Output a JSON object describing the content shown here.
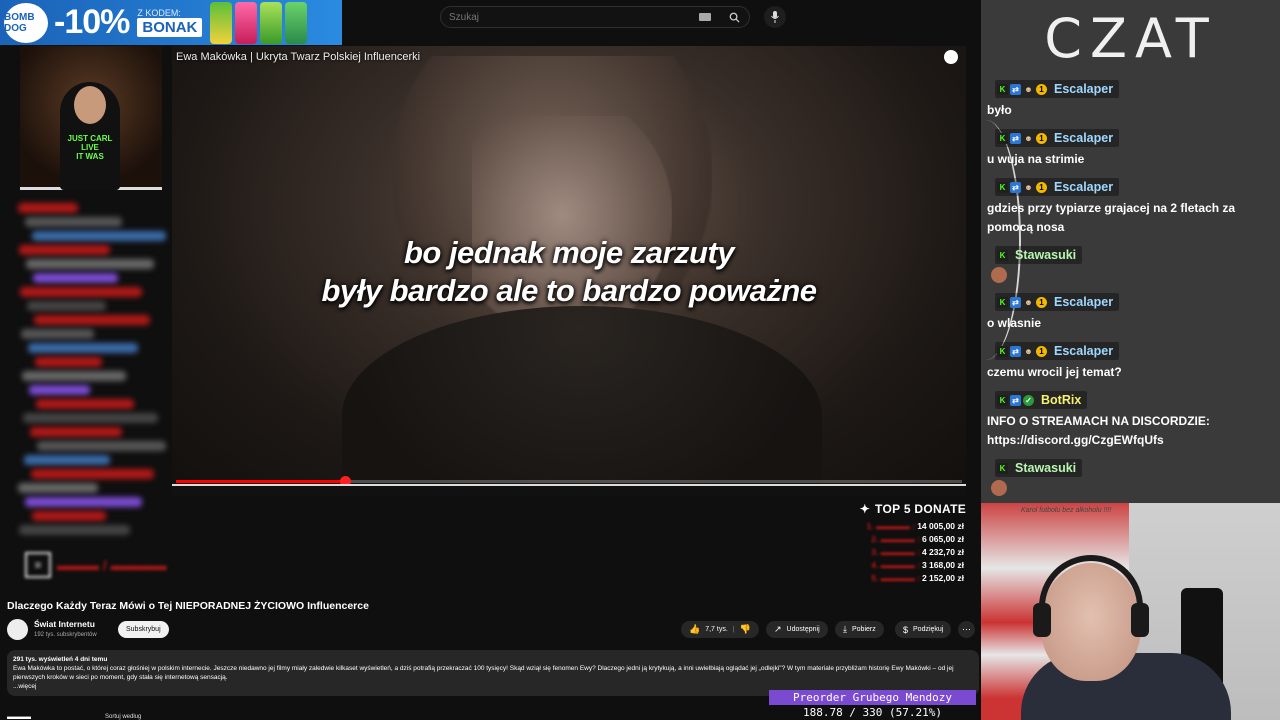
{
  "promo": {
    "discount": "-10%",
    "code_label": "Z KODEM:",
    "code": "BONAK",
    "logo": "BOMB DOG"
  },
  "search": {
    "placeholder": "Szukaj"
  },
  "video": {
    "title": "Ewa Makówka | Ukryta Twarz Polskiej Influencerki",
    "subtitle_line1": "bo jednak moje zarzuty",
    "subtitle_line2": "były bardzo ale to bardzo poważne",
    "progress": 0.215
  },
  "donates": {
    "header": "TOP 5 DONATE",
    "rows": [
      {
        "rank": "1.",
        "amount": "14 005,00 zł"
      },
      {
        "rank": "2.",
        "amount": "6 065,00 zł"
      },
      {
        "rank": "3.",
        "amount": "4 232,70 zł"
      },
      {
        "rank": "4.",
        "amount": "3 168,00 zł"
      },
      {
        "rank": "5.",
        "amount": "2 152,00 zł"
      }
    ]
  },
  "page": {
    "title": "Dlaczego Każdy Teraz Mówi o Tej NIEPORADNEJ ŻYCIOWO Influencerce",
    "channel_name": "Świat Internetu",
    "channel_subs": "192 tys. subskrybentów",
    "subscribe": "Subskrybuj",
    "likes": "7,7 tys.",
    "share": "Udostępnij",
    "download": "Pobierz",
    "thanks": "Podziękuj",
    "desc_meta": "291 tys. wyświetleń  4 dni temu",
    "desc_text": "Ewa Makówka to postać, o której coraz głośniej w polskim internecie. Jeszcze niedawno jej filmy miały zaledwie kilkaset wyświetleń, a dziś potrafią przekraczać 100 tysięcy! Skąd wziął się fenomen Ewy? Dlaczego jedni ją krytykują, a inni uwielbiają oglądać jej „odlejki\"? W tym materiale przybliżam historię Ewy Makówki – od jej pierwszych kroków w sieci po moment, gdy stała się internetową sensacją.",
    "desc_more": "...więcej",
    "sort_label": "Sortuj według"
  },
  "preorder": {
    "label": "Preorder Grubego Mendozy",
    "progress_text": "188.78 / 330 (57.21%)"
  },
  "chat": {
    "title": "CZAT",
    "messages": [
      {
        "user": "Escalaper",
        "color": "#9fd8ff",
        "badges": [
          "k",
          "v",
          "g",
          "o"
        ],
        "text": "było"
      },
      {
        "user": "Escalaper",
        "color": "#9fd8ff",
        "badges": [
          "k",
          "v",
          "g",
          "o"
        ],
        "text": "u wuja na strimie"
      },
      {
        "user": "Escalaper",
        "color": "#9fd8ff",
        "badges": [
          "k",
          "v",
          "g",
          "o"
        ],
        "text": "gdzies przy typiarze grajacej na 2 fletach za pomocą nosa"
      },
      {
        "user": "Stawasuki",
        "color": "#b8f7b0",
        "badges": [
          "k"
        ],
        "text": ""
      },
      {
        "user": "Escalaper",
        "color": "#9fd8ff",
        "badges": [
          "k",
          "v",
          "g",
          "o"
        ],
        "text": "o wlasnie"
      },
      {
        "user": "Escalaper",
        "color": "#9fd8ff",
        "badges": [
          "k",
          "v",
          "g",
          "o"
        ],
        "text": "czemu wrocil jej temat?"
      },
      {
        "user": "BotRix",
        "color": "#f7f26a",
        "badges": [
          "k",
          "v",
          "c"
        ],
        "text": "INFO O STREAMACH NA DISCORDZIE: https://discord.gg/CzgEWfqUfs"
      },
      {
        "user": "Stawasuki",
        "color": "#b8f7b0",
        "badges": [
          "k"
        ],
        "text": ""
      }
    ]
  },
  "cam2": {
    "poster_text": "Karol futbolu bez alkoholu !!!!"
  },
  "colors": {
    "accent_red": "#ff0000",
    "preorder_bg": "#7a4bd1",
    "chat_bg": "#3a3a3a"
  },
  "icons": [
    "search-icon",
    "mic-icon",
    "keyboard-icon",
    "clock-icon",
    "like-icon",
    "dislike-icon",
    "share-icon",
    "download-icon",
    "thanks-icon",
    "more-icon"
  ]
}
